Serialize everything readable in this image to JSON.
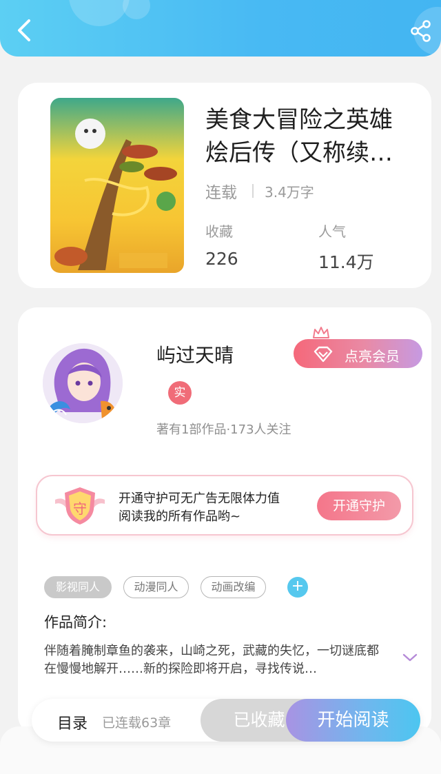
{
  "header": {
    "back_icon": "chevron-left-icon",
    "share_icon": "share-icon"
  },
  "book": {
    "title": "美食大冒险之英雄烩后传（又称续…",
    "status": "连载",
    "word_count": "3.4万字",
    "favorites_label": "收藏",
    "favorites_value": "226",
    "popularity_label": "人气",
    "popularity_value": "11.4万"
  },
  "author": {
    "name": "屿过天晴",
    "verified_badge": "实",
    "stats": "著有1部作品·173人关注",
    "vip_button": "点亮会员"
  },
  "guard": {
    "shield_text": "守",
    "line1": "开通守护可无广告无限体力值",
    "line2": "阅读我的所有作品哟~",
    "button": "开通守护"
  },
  "tags": [
    "影视同人",
    "动漫同人",
    "动画改编"
  ],
  "tag_add": "+",
  "intro": {
    "title": "作品简介:",
    "text": "伴随着腌制章鱼的袭来，山崎之死，武藏的失忆，一切谜底都在慢慢地解开……新的探险即将开启，寻找传说…"
  },
  "bottom_bar": {
    "toc_label": "目录",
    "chapters": "已连载63章",
    "favorited_button": "已收藏",
    "read_button": "开始阅读"
  },
  "colors": {
    "header": "#48b9f3",
    "accent_pink": "#f5687a",
    "accent_blue": "#4cc6f0"
  }
}
